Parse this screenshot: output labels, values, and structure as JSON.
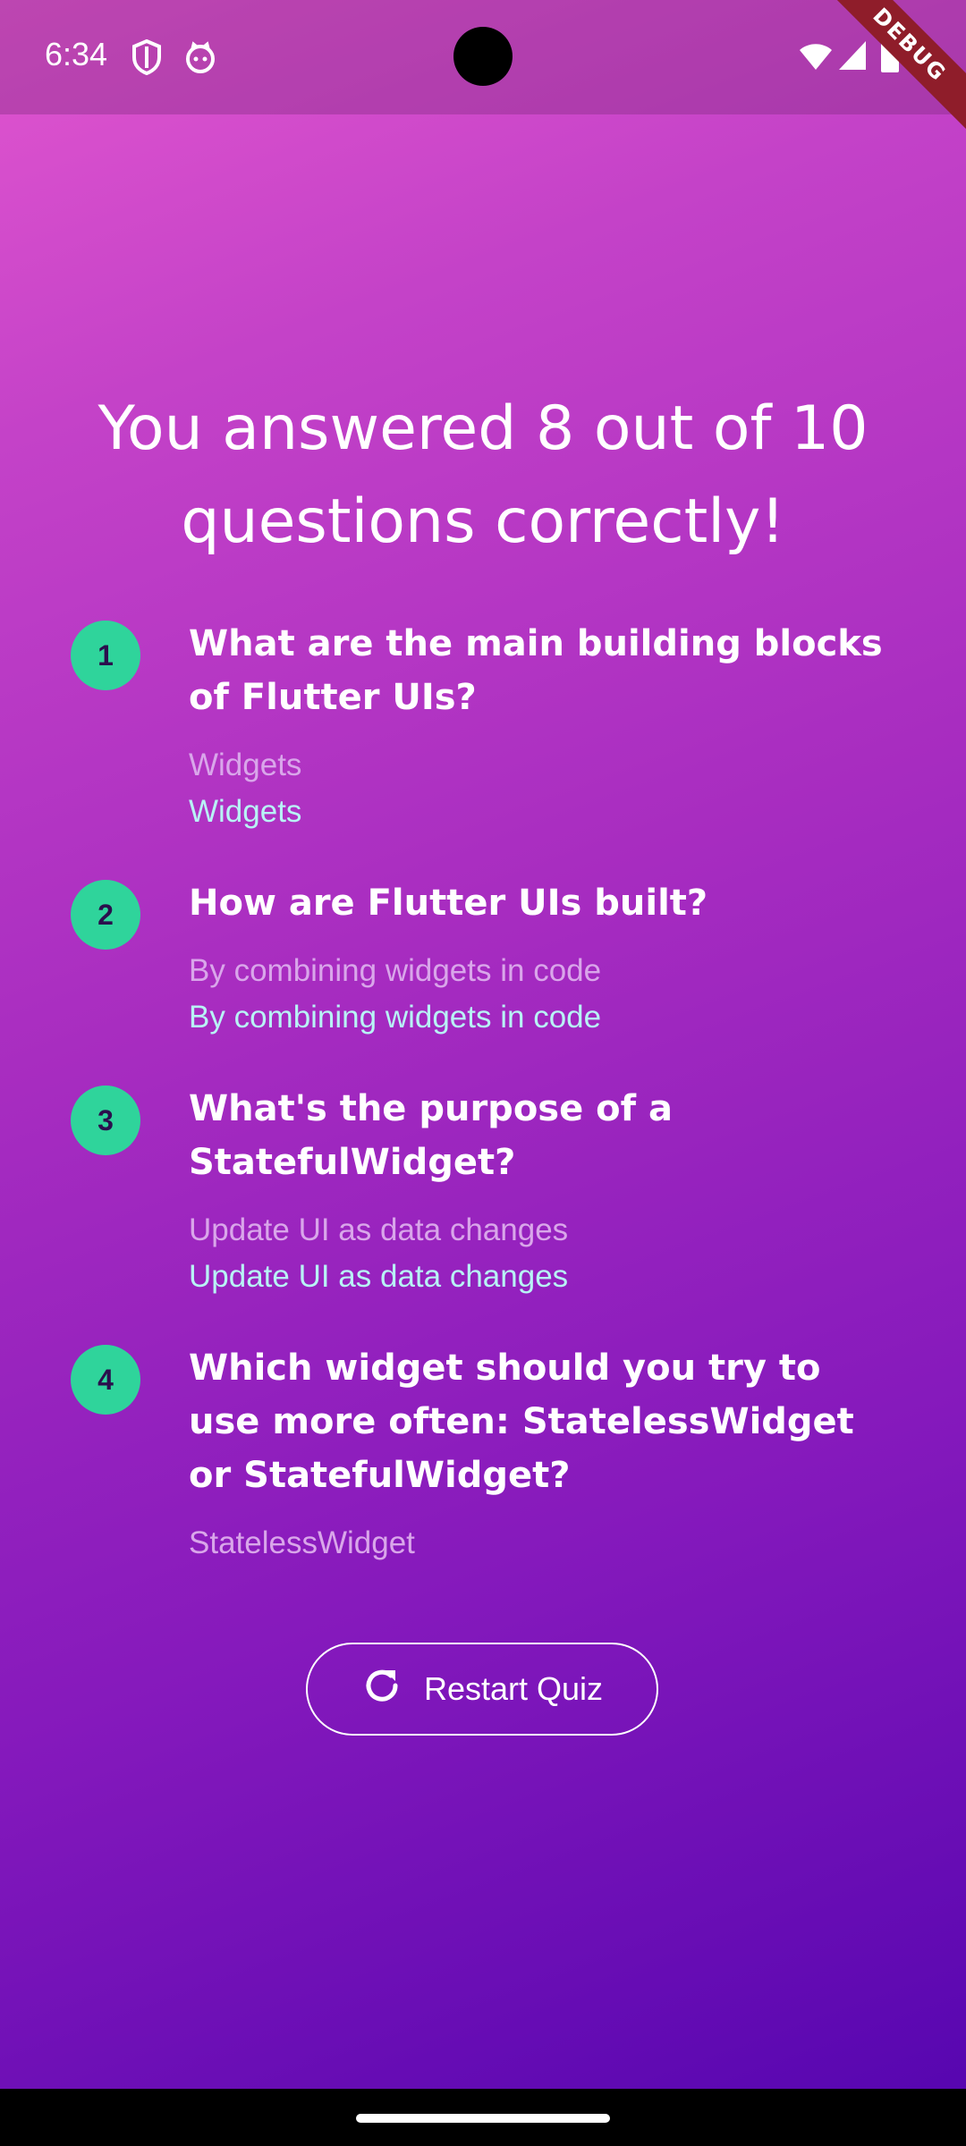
{
  "status_bar": {
    "time": "6:34",
    "icons": [
      "shield-icon",
      "cat-icon",
      "wifi-icon",
      "signal-icon",
      "battery-icon"
    ]
  },
  "debug_banner": "DEBUG",
  "headline": "You answered 8 out of 10 questions correctly!",
  "summary": [
    {
      "number": "1",
      "question": "What are the main building blocks of Flutter UIs?",
      "user_answer": "Widgets",
      "correct_answer": "Widgets"
    },
    {
      "number": "2",
      "question": "How are Flutter UIs built?",
      "user_answer": "By combining widgets in code",
      "correct_answer": "By combining widgets in code"
    },
    {
      "number": "3",
      "question": "What's the purpose of a StatefulWidget?",
      "user_answer": "Update UI as data changes",
      "correct_answer": "Update UI as data changes"
    },
    {
      "number": "4",
      "question": "Which widget should you try to use more often: StatelessWidget or StatefulWidget?",
      "user_answer": "StatelessWidget",
      "correct_answer": ""
    }
  ],
  "restart_button": {
    "label": "Restart Quiz",
    "icon": "refresh-icon"
  },
  "colors": {
    "badge": "#2fd49b",
    "user_answer": "#d9a6ea",
    "correct_answer": "#b8f3f5",
    "gradient_start": "#e256cf",
    "gradient_end": "#5706b0"
  }
}
